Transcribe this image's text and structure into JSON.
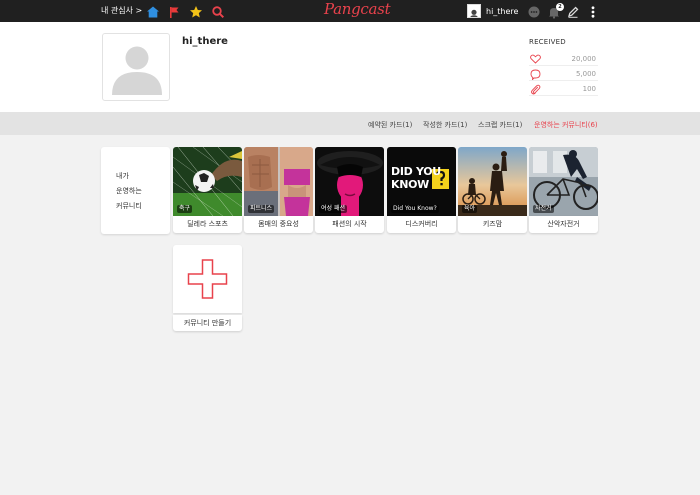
{
  "topbar": {
    "interest_label": "내 관심사 >",
    "logo_text": "Pangcast",
    "username": "hi_there",
    "notification_count": "2",
    "icons": [
      "home-icon",
      "flag-icon",
      "star-icon",
      "search-icon",
      "chat-icon",
      "bell-icon",
      "pencil-icon",
      "more-icon"
    ]
  },
  "profile": {
    "name": "hi_there",
    "received_label": "RECEIVED",
    "stats": [
      {
        "icon": "heart-icon",
        "value": "20,000"
      },
      {
        "icon": "comment-icon",
        "value": "5,000"
      },
      {
        "icon": "clip-icon",
        "value": "100"
      }
    ]
  },
  "tabs": [
    {
      "label": "예약된 카드(1)",
      "active": false
    },
    {
      "label": "작성한 카드(1)",
      "active": false
    },
    {
      "label": "스크랩 카드(1)",
      "active": false
    },
    {
      "label": "운영하는 커뮤니티(6)",
      "active": true
    }
  ],
  "menu": {
    "lines": [
      "내가",
      "운영하는",
      "커뮤니티"
    ]
  },
  "communities": [
    {
      "tag": "축구",
      "title": "딜레라 스포츠"
    },
    {
      "tag": "피트니스",
      "title": "몸매의 중요성"
    },
    {
      "tag": "여성 패션",
      "title": "패션의 시작"
    },
    {
      "tag": "Did You Know?",
      "title": "디스커버리",
      "image_text": [
        "DID YOU",
        "KNOW"
      ]
    },
    {
      "tag": "육아",
      "title": "키즈맘"
    },
    {
      "tag": "자전거",
      "title": "산악자전거"
    }
  ],
  "create": {
    "label": "커뮤니티 만들기"
  },
  "colors": {
    "accent": "#e8424c",
    "topbar_bg": "#202020",
    "page_bg": "#f2f2f2"
  }
}
